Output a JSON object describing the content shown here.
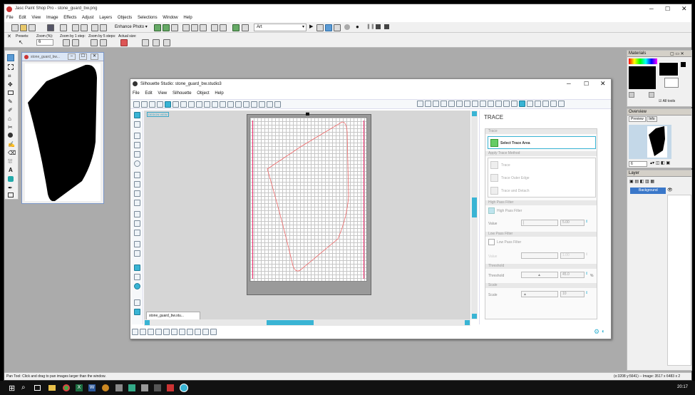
{
  "psp": {
    "title": "Jasc Paint Shop Pro - stone_guard_bw.png",
    "menu": [
      "File",
      "Edit",
      "View",
      "Image",
      "Effects",
      "Adjust",
      "Layers",
      "Objects",
      "Selections",
      "Window",
      "Help"
    ],
    "enhance_photo": "Enhance Photo",
    "art_select": "Art",
    "tool_opt_labels": [
      "Presets:",
      "Zoom (%):",
      "Zoom by 1 step:",
      "Zoom by 5 steps:",
      "Actual size:"
    ],
    "zoom_value": "6",
    "doc_title": "stone_guard_bw...",
    "status_left": "Pan Tool: Click and drag to pan images larger than the window.",
    "status_right": "(x:3208 y:5641) -- Image: 3517 x 6483 x 2",
    "materials_title": "Materials",
    "all_tools": "All tools",
    "overview_title": "Overview",
    "overview_tabs": [
      "Preview",
      "Info"
    ],
    "layer_title": "Layer",
    "layer_name": "Background"
  },
  "silhouette": {
    "title": "Silhouette Studio: stone_guard_bw.studio3",
    "menu": [
      "File",
      "Edit",
      "View",
      "Silhouette",
      "Object",
      "Help"
    ],
    "design_view": "DESIGN VIEW",
    "doc_tab": "stone_guard_bw.stu...",
    "trace_panel": {
      "title": "TRACE",
      "sec_trace": "Trace",
      "select_area": "Select Trace Area",
      "sec_method": "Apply Trace Method",
      "methods": [
        "Trace",
        "Trace Outer Edge",
        "Trace and Detach"
      ],
      "sec_high": "High Pass Filter",
      "high_pass_label": "High Pass Filter",
      "value_label": "Value",
      "high_value": "5.00",
      "sec_low": "Low Pass Filter",
      "low_pass_label": "Low Pass Filter",
      "low_value_label": "Value",
      "low_value": "1.00",
      "sec_threshold": "Threshold",
      "threshold_label": "Threshold",
      "threshold_value": "45.0",
      "threshold_unit": "%",
      "sec_scale": "Scale",
      "scale_label": "Scale",
      "scale_value": "10"
    }
  },
  "taskbar": {
    "time": "20:17"
  }
}
